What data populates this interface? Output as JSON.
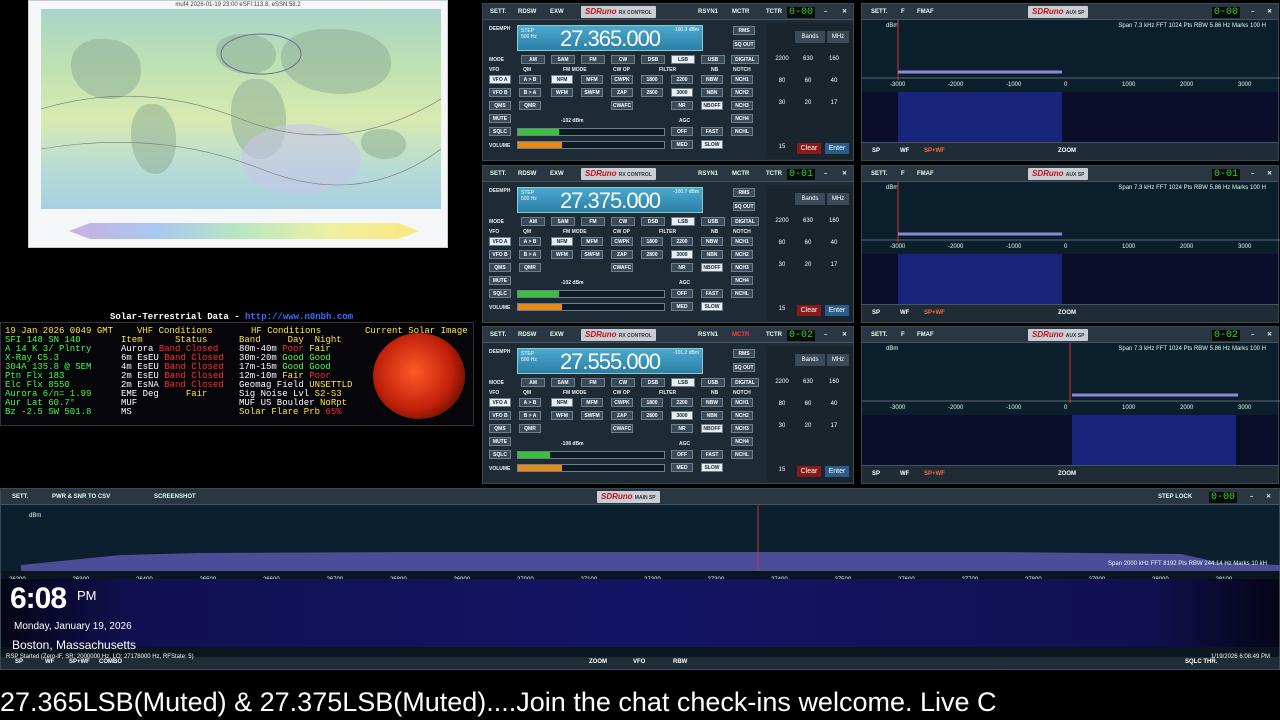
{
  "solar_map": {
    "title": "muf4 2026-01-19 23:00 eSFI:113.8, eSSN:58.2"
  },
  "solar_terrestrial": {
    "title": "Solar-Terrestrial Data - ",
    "url": "http://www.n0nbh.com",
    "date": "19 Jan 2026 0049 GMT",
    "left": [
      "SFI 148  SN   140",
      "A  14 K 3/ Plntry",
      "X-Ray C5.3",
      "304A  135.8 @ SEM",
      "Ptn Flx  183",
      "Elc Flx  8550",
      "Aurora   6/n= 1.99",
      "Aur Lat  60.7°",
      "Bz  -2.5 SW 501.8"
    ],
    "vhf_header": "VHF Conditions",
    "vhf_cols": [
      "Item",
      "Status"
    ],
    "vhf_rows": [
      [
        "Aurora",
        "Band Closed"
      ],
      [
        "6m EsEU",
        "Band Closed"
      ],
      [
        "4m EsEU",
        "Band Closed"
      ],
      [
        "2m EsEU",
        "Band Closed"
      ],
      [
        "2m EsNA",
        "Band Closed"
      ]
    ],
    "eme": [
      "EME Deg",
      "Fair"
    ],
    "muf": "MUF",
    "ms": "MS",
    "hf_header": "HF Conditions",
    "hf_cols": [
      "Band",
      "Day",
      "Night"
    ],
    "hf_rows": [
      [
        "80m-40m",
        "Poor",
        "Fair"
      ],
      [
        "30m-20m",
        "Good",
        "Good"
      ],
      [
        "17m-15m",
        "Good",
        "Good"
      ],
      [
        "12m-10m",
        "Fair",
        "Poor"
      ]
    ],
    "geomag": [
      "Geomag Field",
      "UNSETTLD"
    ],
    "signoise": [
      "Sig Noise Lvl",
      "S2-S3"
    ],
    "muf_us": [
      "MUF US Boulder",
      "NoRpt"
    ],
    "flare": [
      "Solar Flare Prb",
      "65%"
    ],
    "image_header": "Current Solar Image"
  },
  "rx_panels": [
    {
      "freq": "27.365.000",
      "step": "STEP",
      "step_val": "500 Hz",
      "dbm": "-100.3 dBm",
      "vnum": "0-00",
      "meter": "-102 dBm",
      "sig": 0.28,
      "vol": 0.3,
      "mctr_red": false
    },
    {
      "freq": "27.375.000",
      "step": "STEP",
      "step_val": "500 Hz",
      "dbm": "-100.7 dBm",
      "vnum": "0-01",
      "meter": "-102 dBm",
      "sig": 0.28,
      "vol": 0.3,
      "mctr_red": false
    },
    {
      "freq": "27.555.000",
      "step": "STEP",
      "step_val": "500 Hz",
      "dbm": "-101.2 dBm",
      "vnum": "0-02",
      "meter": "-108 dBm",
      "sig": 0.22,
      "vol": 0.3,
      "mctr_red": true
    }
  ],
  "rx_labels": {
    "sett": "SETT.",
    "rdsw": "RDSW",
    "exw": "EXW",
    "logo": "SDRuno",
    "logo_sub": "RX CONTROL",
    "rsyn": "RSYN1",
    "mctr": "MCTR",
    "tctr": "TCTR",
    "deemph": "DEEMPH",
    "mode": "MODE",
    "vfo": "VFO",
    "qm": "QM",
    "fm_mode": "FM MODE",
    "cw_op": "CW OP",
    "filter": "FILTER",
    "nb": "NB",
    "notch": "NOTCH",
    "rms": "RMS",
    "sqout": "SQ OUT",
    "modes": [
      "AM",
      "SAM",
      "FM",
      "CW",
      "DSB",
      "LSB",
      "USB",
      "DIGITAL"
    ],
    "vfoa": "VFO A",
    "vfob": "VFO B",
    "ab": "A > B",
    "ba": "B > A",
    "qms": "QMS",
    "qmr": "QMR",
    "nfm": "NFM",
    "mfm": "MFM",
    "wfm": "WFM",
    "swfm": "SWFM",
    "cwpk": "CWPK",
    "zap": "ZAP",
    "cwafc": "CWAFC",
    "f1800": "1800",
    "f2200": "2200",
    "f2800": "2800",
    "f3000": "3000",
    "nr": "NR",
    "nbw": "NBW",
    "nbn": "NBN",
    "nboff": "NBOFF",
    "nch1": "NCH1",
    "nch2": "NCH2",
    "nch3": "NCH3",
    "nch4": "NCH4",
    "nchl": "NCHL",
    "mute": "MUTE",
    "sqlc": "SQLC",
    "volume": "VOLUME",
    "agc": "AGC",
    "off": "OFF",
    "fast": "FAST",
    "med": "MED",
    "slow": "SLOW",
    "bands": "Bands",
    "mhz": "MHz",
    "clear": "Clear",
    "enter": "Enter",
    "keys": [
      "2200",
      "630",
      "160",
      "80",
      "60",
      "40",
      "30",
      "20",
      "17",
      "15"
    ]
  },
  "sp_panels": [
    {
      "vnum": "0-00",
      "span": "Span 7.3 kHz   FFT 1024 Pts   RBW 5.86 Hz   Marks 100 H"
    },
    {
      "vnum": "0-01",
      "span": "Span 7.3 kHz   FFT 1024 Pts   RBW 5.86 Hz   Marks 100 H"
    },
    {
      "vnum": "0-02",
      "span": "Span 7.3 kHz   FFT 1024 Pts   RBW 5.86 Hz   Marks 100 H"
    }
  ],
  "sp_labels": {
    "sett": "SETT.",
    "f": "F",
    "fmaf": "FMAF",
    "logo": "SDRuno",
    "logo_sub": "AUX SP",
    "dbm": "dBm",
    "sp": "SP",
    "wf": "WF",
    "spwf": "SP+WF",
    "zoom": "ZOOM",
    "axis": [
      "-3000",
      "-2000",
      "-1000",
      "0",
      "1000",
      "2000",
      "3000"
    ]
  },
  "main": {
    "sett": "SETT.",
    "pwr": "PWR & SNR TO CSV",
    "shot": "SCREENSHOT",
    "logo": "SDRuno",
    "logo_sub": "MAIN SP",
    "steplock": "STEP LOCK",
    "vnum": "0-00",
    "dbm": "dBm",
    "axis": [
      "26200",
      "26300",
      "26400",
      "26500",
      "26600",
      "26700",
      "26800",
      "26900",
      "27000",
      "27100",
      "27200",
      "27300",
      "27400",
      "27500",
      "27600",
      "27700",
      "27800",
      "27900",
      "28000",
      "28100"
    ],
    "span": "Span 2000 kHz   FFT 8192 Pts   RBW 244.14 Hz   Marks 10 kH",
    "sp": "SP",
    "wf": "WF",
    "spwf": "SP+WF",
    "combo": "COMBO",
    "zoom": "ZOOM",
    "vfo": "VFO",
    "rbw": "RBW",
    "sqlcthr": "SQLC THR."
  },
  "overlay": {
    "clock": "6:08",
    "ampm": "PM",
    "date": "Monday, January 19, 2026",
    "location": "Boston, Massachusetts",
    "status": "RSP Started (Zero-IF, SR: 2000000 Hz, LO: 27178000 Hz, RFState: 5)",
    "stamp": "1/19/2026 6:08:49 PM"
  },
  "ticker": "27.365LSB(Muted) & 27.375LSB(Muted)....Join the chat check-ins welcome.          Live C"
}
